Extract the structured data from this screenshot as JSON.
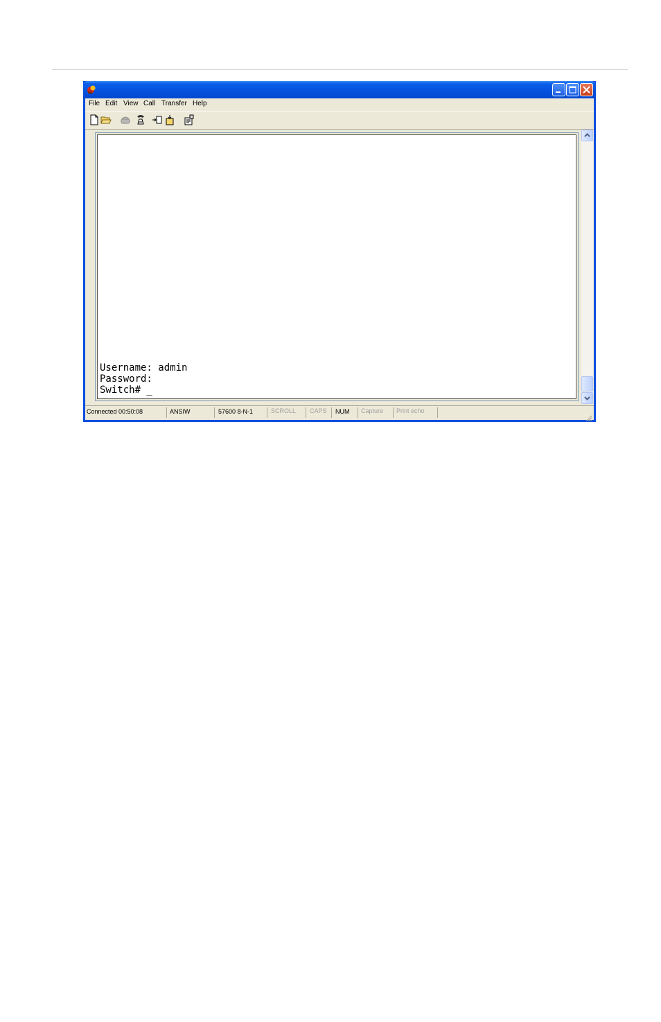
{
  "window": {
    "title": "",
    "menu": [
      "File",
      "Edit",
      "View",
      "Call",
      "Transfer",
      "Help"
    ],
    "toolbar_icons": [
      "new-document-icon",
      "open-folder-icon",
      "disconnect-phone-icon",
      "dial-icon",
      "send-file-icon",
      "receive-file-icon",
      "properties-icon"
    ]
  },
  "terminal": {
    "lines": [
      "Username: admin",
      "Password:",
      "Switch# _"
    ]
  },
  "statusbar": {
    "connection": "Connected 00:50:08",
    "emulation": "ANSIW",
    "port_settings": "57600 8-N-1",
    "scroll": "SCROLL",
    "caps": "CAPS",
    "num": "NUM",
    "capture": "Capture",
    "print_echo": "Print echo"
  },
  "colors": {
    "titlebar": "#0451dd",
    "chrome": "#ece9d8",
    "close_button": "#c6401c"
  }
}
